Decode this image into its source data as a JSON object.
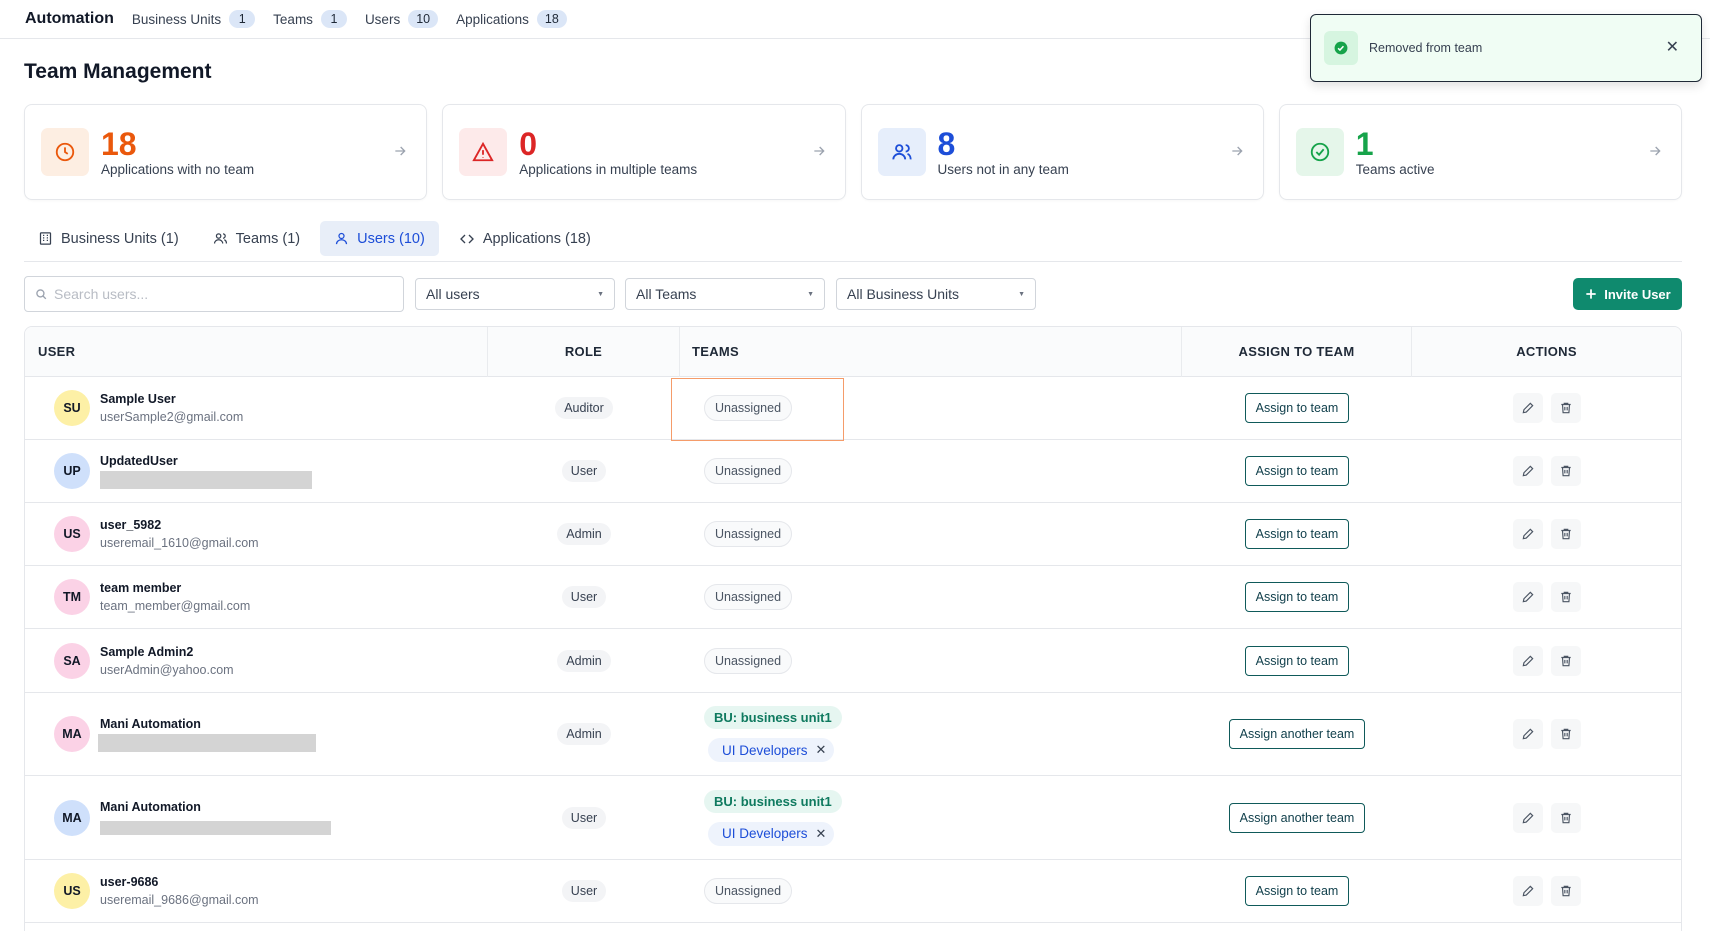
{
  "nav": {
    "brand": "Automation",
    "items": [
      {
        "label": "Business Units",
        "count": "1"
      },
      {
        "label": "Teams",
        "count": "1"
      },
      {
        "label": "Users",
        "count": "10"
      },
      {
        "label": "Applications",
        "count": "18"
      }
    ]
  },
  "page": {
    "title": "Team Management"
  },
  "stats": [
    {
      "value": "18",
      "label": "Applications with no team",
      "color": "#ea580c",
      "icon": "clock-icon"
    },
    {
      "value": "0",
      "label": "Applications in multiple teams",
      "color": "#dc2626",
      "icon": "warning-icon"
    },
    {
      "value": "8",
      "label": "Users not in any team",
      "color": "#1d4ed8",
      "icon": "users-icon"
    },
    {
      "value": "1",
      "label": "Teams active",
      "color": "#16a34a",
      "icon": "check-circle-icon"
    }
  ],
  "tabs": [
    {
      "label": "Business Units (1)",
      "icon": "building-icon"
    },
    {
      "label": "Teams (1)",
      "icon": "users-icon"
    },
    {
      "label": "Users (10)",
      "icon": "user-icon",
      "active": true
    },
    {
      "label": "Applications (18)",
      "icon": "code-icon"
    }
  ],
  "filters": {
    "search_placeholder": "Search users...",
    "users_select": "All users",
    "teams_select": "All Teams",
    "bu_select": "All Business Units",
    "invite_label": "Invite User"
  },
  "table": {
    "headers": {
      "user": "USER",
      "role": "ROLE",
      "teams": "TEAMS",
      "assign": "ASSIGN TO TEAM",
      "actions": "ACTIONS"
    },
    "rows": [
      {
        "initials": "SU",
        "name": "Sample User",
        "email": "userSample2@gmail.com",
        "role": "Auditor",
        "team": "Unassigned",
        "assign": "Assign to team"
      },
      {
        "initials": "UP",
        "name": "UpdatedUser",
        "email": "",
        "role": "User",
        "team": "Unassigned",
        "assign": "Assign to team"
      },
      {
        "initials": "US",
        "name": "user_5982",
        "email": "useremail_1610@gmail.com",
        "role": "Admin",
        "team": "Unassigned",
        "assign": "Assign to team"
      },
      {
        "initials": "TM",
        "name": "team member",
        "email": "team_member@gmail.com",
        "role": "User",
        "team": "Unassigned",
        "assign": "Assign to team"
      },
      {
        "initials": "SA",
        "name": "Sample Admin2",
        "email": "userAdmin@yahoo.com",
        "role": "Admin",
        "team": "Unassigned",
        "assign": "Assign to team"
      },
      {
        "initials": "MA",
        "name": "Mani Automation",
        "email": "",
        "role": "Admin",
        "bu": "BU: business unit1",
        "team": "UI Developers",
        "assign": "Assign another team"
      },
      {
        "initials": "MA",
        "name": "Mani Automation",
        "email": "",
        "role": "User",
        "bu": "BU: business unit1",
        "team": "UI Developers",
        "assign": "Assign another team"
      },
      {
        "initials": "US",
        "name": "user-9686",
        "email": "useremail_9686@gmail.com",
        "role": "User",
        "team": "Unassigned",
        "assign": "Assign to team"
      }
    ],
    "avatar_colors": {
      "yellow": "#fdf0a6",
      "blue": "#cfe0fb",
      "pink": "#fbd2e6"
    }
  },
  "toast": {
    "message": "Removed from team",
    "status_color": "#16a34a"
  }
}
